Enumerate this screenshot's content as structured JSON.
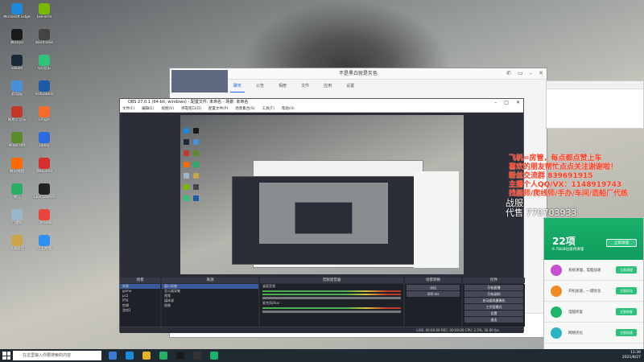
{
  "desktop": {
    "icons": [
      {
        "label": "Microsoft Edge",
        "color": "#1c8ad8"
      },
      {
        "label": "腾讯QQ",
        "color": "#1a1a1a"
      },
      {
        "label": "Steam",
        "color": "#1b2838"
      },
      {
        "label": "此电脑",
        "color": "#4a90d9"
      },
      {
        "label": "网易云音乐",
        "color": "#c0392b"
      },
      {
        "label": "Minecraft",
        "color": "#5c8a2d"
      },
      {
        "label": "腾讯视频",
        "color": "#ff6a00"
      },
      {
        "label": "微信",
        "color": "#2aae67"
      },
      {
        "label": "回收站",
        "color": "#9bb5c9"
      },
      {
        "label": "英雄联盟",
        "color": "#c9a44a"
      },
      {
        "label": "GeForce",
        "color": "#76b900"
      },
      {
        "label": "Warframe",
        "color": "#444"
      },
      {
        "label": "QQ音乐",
        "color": "#31c27c"
      },
      {
        "label": "VirtualBox",
        "color": "#1c5aa8"
      },
      {
        "label": "Origin",
        "color": "#f56c2d"
      },
      {
        "label": "Uplay",
        "color": "#2d6ae0"
      },
      {
        "label": "WeGame",
        "color": "#d32f2f"
      },
      {
        "label": "Epic Games",
        "color": "#222"
      },
      {
        "label": "Chrome",
        "color": "#e8453c"
      },
      {
        "label": "百度网盘",
        "color": "#2f8ff2"
      }
    ]
  },
  "chat": {
    "title": "不是黑白就是灰色",
    "tabs": [
      "聊天",
      "公告",
      "相册",
      "文件",
      "应用",
      "设置"
    ],
    "active_tab": "聊天"
  },
  "obs": {
    "title": "OBS 27.0.1 (64-bit, windows) - 配置文件: 未命名 - 场景: 未命名",
    "menu": [
      "文件(F)",
      "编辑(E)",
      "视图(V)",
      "停靠窗口(D)",
      "配置文件(P)",
      "场景集合(S)",
      "工具(T)",
      "帮助(H)"
    ],
    "docks": {
      "scenes": {
        "title": "场景",
        "items": [
          "场景",
          "game",
          "ps2",
          "PTK",
          "剪辑",
          "游戏2"
        ]
      },
      "sources": {
        "title": "来源",
        "items": [
          "窗口采集",
          "显示器采集",
          "视频",
          "媒体源",
          "图像"
        ]
      },
      "mixer": {
        "title": "音频混音器",
        "tracks": [
          "桌面音频",
          "麦克风/Aux"
        ]
      },
      "transitions": {
        "title": "场景转换",
        "type": "淡出",
        "duration": "300 ms"
      },
      "controls": {
        "title": "控件",
        "buttons": [
          "开始直播",
          "开始录制",
          "启动虚拟摄像机",
          "工作室模式",
          "设置",
          "退出"
        ]
      }
    },
    "status": "LIVE: 00:00:00   REC: 00:00:00   CPU: 2.5%, 30.00 fps"
  },
  "overlay": {
    "lines": [
      "飞机=房管，每点都点赞上车",
      "喜欢的朋友帮忙点点关注谢谢啦！",
      "粉丝交流群 839691915",
      "主播个人QQ/VX：1148919743",
      "找画师/爬线师/手办/车间/造船厂代练"
    ],
    "lines2": [
      "战服",
      "代售 770703933"
    ]
  },
  "security": {
    "score": "22项",
    "subtitle": "6.78GB垃圾待清理",
    "action_button": "立即清理",
    "items": [
      {
        "text": "系统清理，电脑加速",
        "button": "立即清理",
        "color": "#c84fd1"
      },
      {
        "text": "开机加速，一键优化",
        "button": "立即优化",
        "color": "#f08c28"
      },
      {
        "text": "电脑修复",
        "button": "立即修复",
        "color": "#1fb36c"
      },
      {
        "text": "网络优化",
        "button": "立即加速",
        "color": "#2bb3c4"
      }
    ]
  },
  "taskbar": {
    "search_placeholder": "在这里输入你要搜索的内容",
    "time": "11:39",
    "date": "2021/8/27"
  }
}
